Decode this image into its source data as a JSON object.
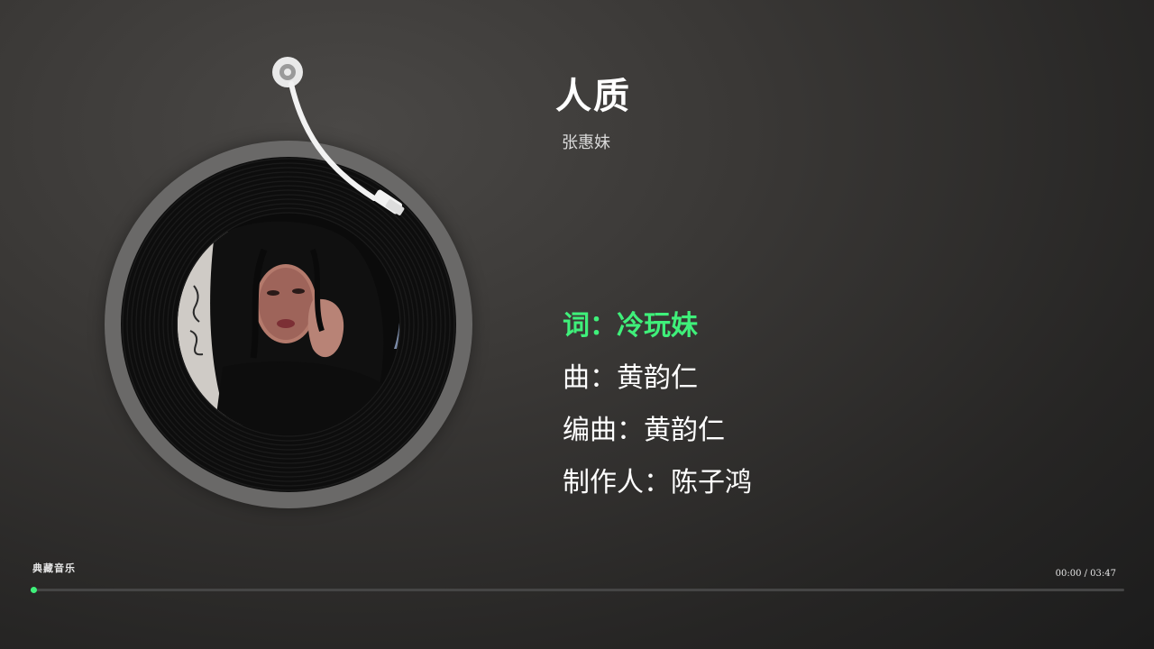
{
  "song": {
    "title": "人质",
    "artist": "张惠妹"
  },
  "credits": [
    {
      "text": "词：冷玩妹",
      "active": true
    },
    {
      "text": "曲：黄韵仁",
      "active": false
    },
    {
      "text": "编曲：黄韵仁",
      "active": false
    },
    {
      "text": "制作人：陈子鸿",
      "active": false
    }
  ],
  "player": {
    "brand": "典藏音乐",
    "time": "00:00 / 03:47",
    "progress_fraction": 0.002
  },
  "colors": {
    "accent": "#3ff07a",
    "vinyl_rim": "#6a6968",
    "vinyl": "#0d0d0d"
  }
}
